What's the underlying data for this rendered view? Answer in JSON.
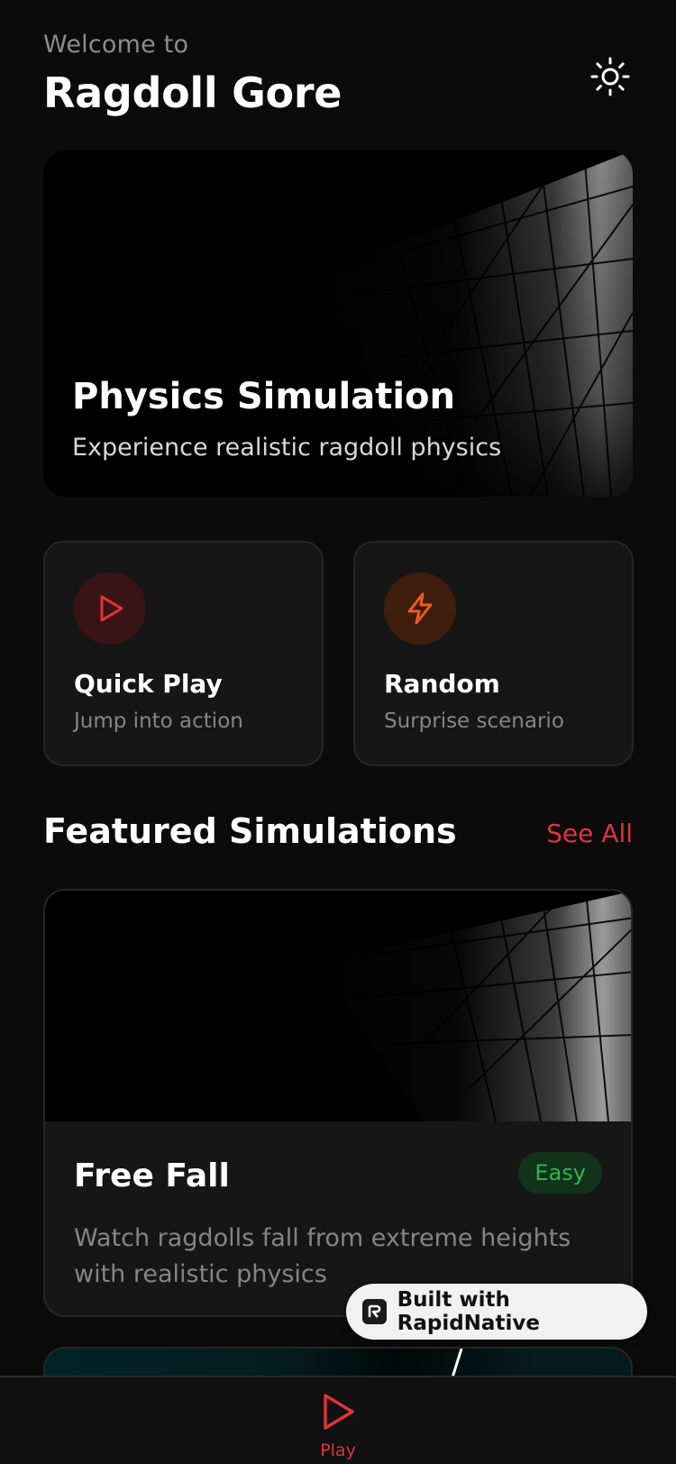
{
  "header": {
    "welcome": "Welcome to",
    "title": "Ragdoll Gore",
    "theme_icon": "sun-icon"
  },
  "hero": {
    "title": "Physics Simulation",
    "subtitle": "Experience realistic ragdoll physics"
  },
  "actions": [
    {
      "title": "Quick Play",
      "subtitle": "Jump into action",
      "icon": "play-icon",
      "color": "#e0333a"
    },
    {
      "title": "Random",
      "subtitle": "Surprise scenario",
      "icon": "lightning-icon",
      "color": "#f05a22"
    }
  ],
  "featured": {
    "section_title": "Featured Simulations",
    "see_all": "See All",
    "cards": [
      {
        "title": "Free Fall",
        "difficulty": "Easy",
        "description": "Watch ragdolls fall from extreme heights with realistic physics"
      }
    ]
  },
  "built_badge": {
    "text": "Built with RapidNative",
    "icon": "rapidnative-logo-icon"
  },
  "bottom_nav": {
    "items": [
      {
        "label": "Play",
        "icon": "play-icon",
        "active": true
      }
    ]
  },
  "colors": {
    "background": "#0b0b0b",
    "card": "#161616",
    "accent": "#e0333a",
    "orange": "#f05a22",
    "easy_green": "#2fb54f"
  }
}
